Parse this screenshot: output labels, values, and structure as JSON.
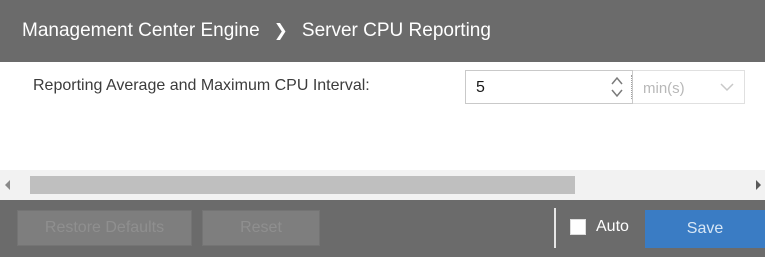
{
  "header": {
    "breadcrumb_parent": "Management Center Engine",
    "breadcrumb_current": "Server CPU Reporting",
    "background_color": "#6b6b6b"
  },
  "form": {
    "cpu_interval_label": "Reporting Average and Maximum CPU Interval:",
    "cpu_interval_value": "5",
    "unit_selected": "min(s)"
  },
  "footer": {
    "restore_defaults_label": "Restore Defaults",
    "reset_label": "Reset",
    "auto_label": "Auto",
    "auto_checked": false,
    "save_label": "Save",
    "save_color": "#3a7cc4"
  },
  "icons": {
    "breadcrumb_separator": "chevron-right-icon",
    "spinner": "up-down-arrows-icon",
    "dropdown": "chevron-down-icon",
    "scroll_left": "scroll-left-arrow-icon",
    "scroll_right": "scroll-right-arrow-icon"
  }
}
